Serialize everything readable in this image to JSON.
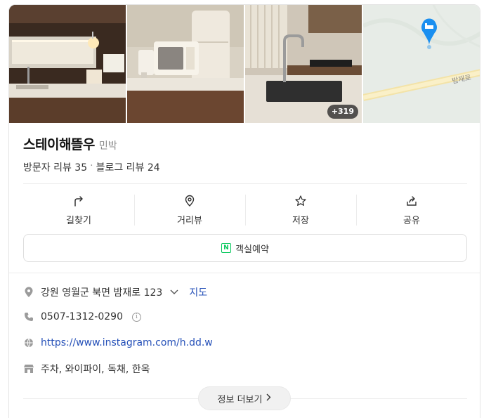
{
  "place": {
    "name": "스테이해뜰우",
    "category": "민박",
    "visitor_reviews": "방문자 리뷰 35",
    "separator": "·",
    "blog_reviews": "블로그 리뷰 24"
  },
  "photos": {
    "more_count": "+319",
    "map_road_label": "밤재로"
  },
  "actions": [
    {
      "label": "길찾기",
      "icon": "directions-icon"
    },
    {
      "label": "거리뷰",
      "icon": "street-view-icon"
    },
    {
      "label": "저장",
      "icon": "star-icon"
    },
    {
      "label": "공유",
      "icon": "share-icon"
    }
  ],
  "reserve": {
    "label": "객실예약",
    "badge": "N"
  },
  "info": {
    "address": "강원 영월군 북면 밤재로 123",
    "map_link": "지도",
    "phone": "0507-1312-0290",
    "phone_info": "i",
    "website": "https://www.instagram.com/h.dd.w",
    "amenities": "주차, 와이파이, 독채, 한옥"
  },
  "more": {
    "label": "정보 더보기"
  },
  "colors": {
    "accent": "#2550b8",
    "naver_green": "#03c75a",
    "map_pin": "#1a8ff0"
  }
}
